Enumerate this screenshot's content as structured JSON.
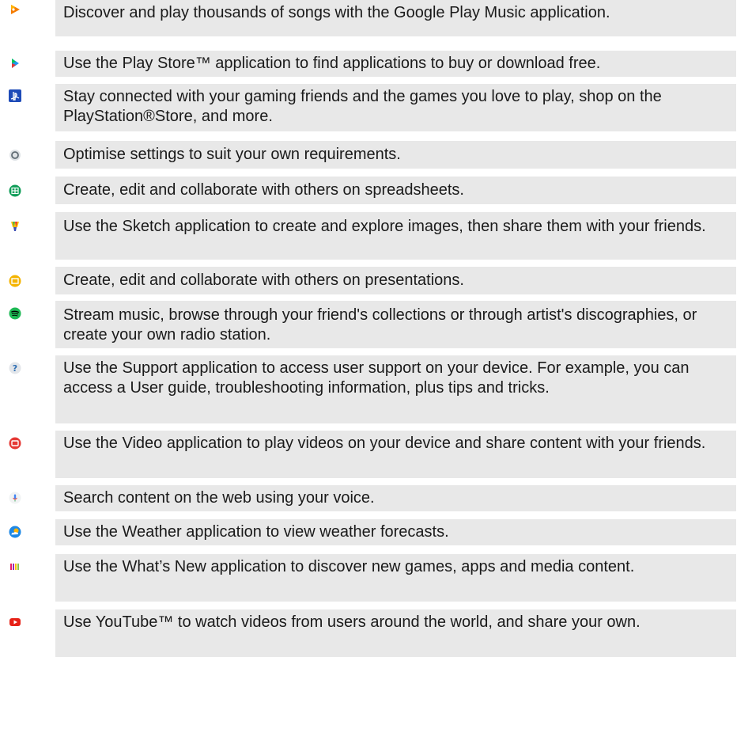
{
  "apps": [
    {
      "icon": "play-music-icon",
      "description": "Discover and play thousands of songs with the Google Play Music application."
    },
    {
      "icon": "play-store-icon",
      "description": "Use the Play Store™ application to find applications to buy or download free."
    },
    {
      "icon": "playstation-icon",
      "description": "Stay connected with your gaming friends and the games you love to play, shop on the PlayStation®Store, and more."
    },
    {
      "icon": "settings-icon",
      "description": "Optimise settings to suit your own requirements."
    },
    {
      "icon": "sheets-icon",
      "description": "Create, edit and collaborate with others on spreadsheets."
    },
    {
      "icon": "sketch-icon",
      "description": "Use the Sketch application to create and explore images, then share them with your friends."
    },
    {
      "icon": "slides-icon",
      "description": "Create, edit and collaborate with others on presentations."
    },
    {
      "icon": "spotify-icon",
      "description": "Stream music, browse through your friend's collections or through artist's discographies, or create your own radio station."
    },
    {
      "icon": "support-icon",
      "description": "Use the Support application to access user support on your device. For example, you can access a User guide, troubleshooting information, plus tips and tricks."
    },
    {
      "icon": "video-icon",
      "description": "Use the Video application to play videos on your device and share content with your friends."
    },
    {
      "icon": "voice-search-icon",
      "description": "Search content on the web using your voice."
    },
    {
      "icon": "weather-icon",
      "description": "Use the Weather application to view weather forecasts."
    },
    {
      "icon": "whats-new-icon",
      "description": "Use the What’s New application to discover new games, apps and media content."
    },
    {
      "icon": "youtube-icon",
      "description": "Use YouTube™ to watch videos from users around the world, and share your own."
    }
  ]
}
